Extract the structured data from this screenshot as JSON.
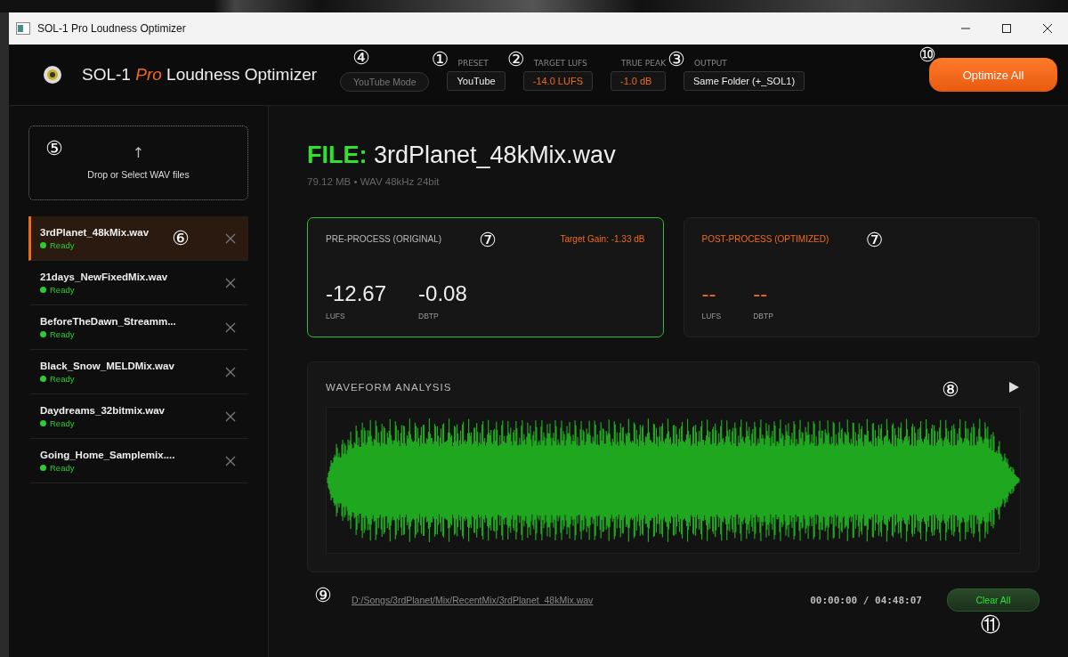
{
  "window": {
    "title": "SOL-1 Pro Loudness Optimizer"
  },
  "header": {
    "brand": "SOL-1",
    "edition": "Pro",
    "product": "Loudness Optimizer",
    "mode_button": {
      "label": "YouTube Mode",
      "callout": "④"
    },
    "fields": [
      {
        "label": "PRESET",
        "value": "YouTube",
        "kind": "plain",
        "callout": "①"
      },
      {
        "label": "TARGET LUFS",
        "value": "-14.0 LUFS",
        "kind": "accent",
        "callout": "②"
      },
      {
        "label": "TRUE PEAK",
        "value": "-1.0 dB",
        "kind": "accent"
      },
      {
        "label": "OUTPUT",
        "value": "Same Folder (+_SOL1)",
        "kind": "plain",
        "callout": "③"
      }
    ],
    "optimize_button": {
      "label": "Optimize All",
      "callout": "⑩"
    }
  },
  "drop_zone": {
    "arrow": "↑",
    "label": "Drop or Select WAV files",
    "callout": "⑤"
  },
  "files": [
    {
      "name": "3rdPlanet_48kMix.wav",
      "status": "Ready",
      "selected": true,
      "callout": "⑥"
    },
    {
      "name": "21days_NewFixedMix.wav",
      "status": "Ready",
      "selected": false
    },
    {
      "name": "BeforeTheDawn_Streamm...",
      "status": "Ready",
      "selected": false
    },
    {
      "name": "Black_Snow_MELDMix.wav",
      "status": "Ready",
      "selected": false
    },
    {
      "name": "Daydreams_32bitmix.wav",
      "status": "Ready",
      "selected": false
    },
    {
      "name": "Going_Home_Samplemix....",
      "status": "Ready",
      "selected": false
    }
  ],
  "file_header": {
    "prefix": "FILE:",
    "name": "3rdPlanet_48kMix.wav",
    "meta": "79.12 MB • WAV 48kHz 24bit"
  },
  "cards": [
    {
      "kind": "pre",
      "title": "PRE-PROCESS (ORIGINAL)",
      "gain": "Target Gain: -1.33 dB",
      "callout": "⑦",
      "metrics": [
        {
          "value": "-12.67",
          "unit": "LUFS"
        },
        {
          "value": "-0.08",
          "unit": "DBTP"
        }
      ]
    },
    {
      "kind": "post",
      "title": "POST-PROCESS (OPTIMIZED)",
      "callout": "⑦",
      "metrics": [
        {
          "value": "--",
          "unit": "LUFS"
        },
        {
          "value": "--",
          "unit": "DBTP"
        }
      ]
    }
  ],
  "waveform": {
    "title": "WAVEFORM ANALYSIS",
    "callout": "⑧"
  },
  "footer": {
    "path": "D:/Songs/3rdPlanet/Mix/RecentMix/3rdPlanet_48kMix.wav",
    "path_callout": "⑨",
    "time": "00:00:00 / 04:48:07",
    "clear_button": "Clear All",
    "clear_callout": "⑪"
  }
}
